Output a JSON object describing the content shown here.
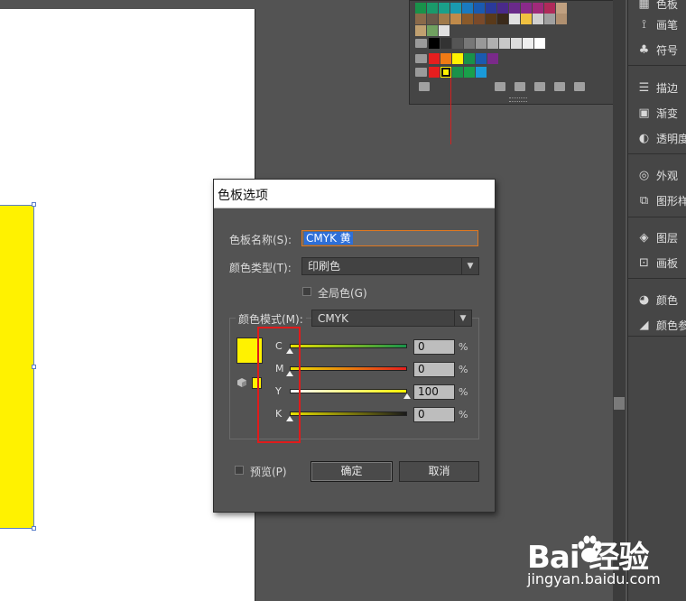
{
  "swatches": {
    "rows": [
      [
        "#19924a",
        "#1a9a6a",
        "#1aa08a",
        "#1a9ab0",
        "#1a7ac0",
        "#1a5ab0",
        "#2a3a9a",
        "#4a2a8a",
        "#6a2a8a",
        "#8a2a8a",
        "#a02a7a",
        "#b02a5a",
        "#c0a080"
      ],
      [
        "#8a6a4a",
        "#6a5a4a",
        "#a07a4a",
        "#c08a4a",
        "#8a5a2a",
        "#7a4a2a",
        "#5a3a1a",
        "#3a2a1a",
        "#e0e0e0",
        "#f0c040",
        "#d0d0d0",
        "#a0a0a0",
        "#b09070"
      ],
      [
        "#c0a070",
        "#70a060",
        "#e0e0e0"
      ],
      [
        "#000000",
        "#333333",
        "#555555",
        "#777777",
        "#999999",
        "#b0b0b0",
        "#c8c8c8",
        "#dddddd",
        "#eeeeee",
        "#ffffff"
      ],
      [
        "#e61e1e",
        "#f07a14",
        "#fff200",
        "#19924a",
        "#1a5ab0",
        "#7a2a8a"
      ],
      [
        "#e61e1e",
        "#fff200",
        "#19924a",
        "#1aa04a",
        "#1a9ad8"
      ]
    ]
  },
  "dock": {
    "items": [
      {
        "label": "色板",
        "icon": "grid-icon"
      },
      {
        "label": "画笔",
        "icon": "brush-icon"
      },
      {
        "label": "符号",
        "icon": "club-icon"
      },
      {
        "label": "描边",
        "icon": "stroke-lines-icon"
      },
      {
        "label": "渐变",
        "icon": "gradient-icon"
      },
      {
        "label": "透明度",
        "icon": "transparency-icon"
      },
      {
        "label": "外观",
        "icon": "appearance-icon"
      },
      {
        "label": "图形样式",
        "icon": "graphic-styles-icon"
      },
      {
        "label": "图层",
        "icon": "layers-icon"
      },
      {
        "label": "画板",
        "icon": "artboards-icon"
      },
      {
        "label": "颜色",
        "icon": "palette-icon"
      },
      {
        "label": "颜色参考",
        "icon": "color-guide-icon"
      }
    ]
  },
  "dialog": {
    "title": "色板选项",
    "name_label": "色板名称(S):",
    "name_value": "CMYK 黄",
    "type_label": "颜色类型(T):",
    "type_value": "印刷色",
    "global_label": "全局色(G)",
    "mode_label": "颜色模式(M):",
    "mode_value": "CMYK",
    "channels": [
      {
        "letter": "C",
        "value": "0",
        "percent": 0,
        "gradient": "linear-gradient(to right,#e8e000,#19924a)"
      },
      {
        "letter": "M",
        "value": "0",
        "percent": 0,
        "gradient": "linear-gradient(to right,#e8e000,#e61e1e)"
      },
      {
        "letter": "Y",
        "value": "100",
        "percent": 100,
        "gradient": "linear-gradient(to right,#ffffff,#fff200)"
      },
      {
        "letter": "K",
        "value": "0",
        "percent": 0,
        "gradient": "linear-gradient(to right,#e8e000,#1a1a1a)"
      }
    ],
    "percent_sign": "%",
    "preview_label": "预览(P)",
    "ok_label": "确定",
    "cancel_label": "取消",
    "swatch_color": "#fff200"
  },
  "watermark": {
    "logo_text": "Bai  经验",
    "url": "jingyan.baidu.com"
  }
}
